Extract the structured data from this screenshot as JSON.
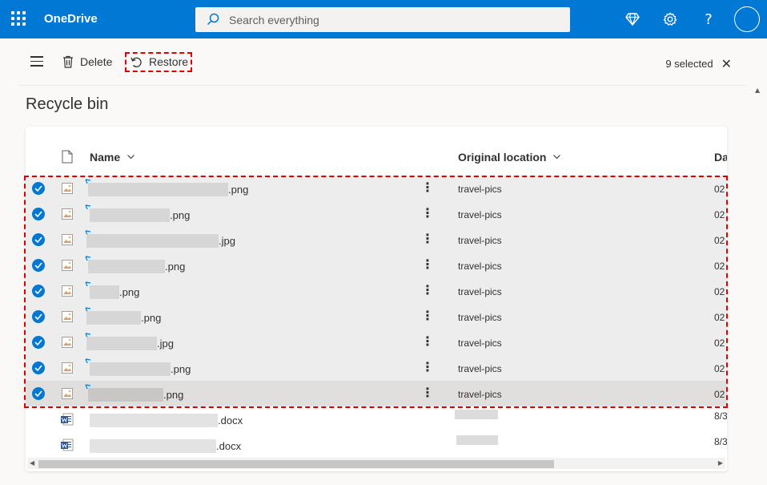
{
  "app": {
    "title": "OneDrive"
  },
  "search": {
    "placeholder": "Search everything"
  },
  "toolbar": {
    "delete_label": "Delete",
    "restore_label": "Restore",
    "selection_count": "9 selected"
  },
  "page": {
    "title": "Recycle bin"
  },
  "table": {
    "columns": {
      "name": "Name",
      "location": "Original location",
      "date": "Da"
    },
    "rows": [
      {
        "ext": ".png",
        "location": "travel-pics",
        "date": "02",
        "selected": true
      },
      {
        "ext": ".png",
        "location": "travel-pics",
        "date": "02",
        "selected": true
      },
      {
        "ext": ".jpg",
        "location": "travel-pics",
        "date": "02",
        "selected": true
      },
      {
        "ext": ".png",
        "location": "travel-pics",
        "date": "02",
        "selected": true
      },
      {
        "ext": ".png",
        "location": "travel-pics",
        "date": "02",
        "selected": true
      },
      {
        "ext": ".png",
        "location": "travel-pics",
        "date": "02",
        "selected": true
      },
      {
        "ext": ".jpg",
        "location": "travel-pics",
        "date": "02",
        "selected": true
      },
      {
        "ext": ".png",
        "location": "travel-pics",
        "date": "02",
        "selected": true
      },
      {
        "ext": ".png",
        "location": "travel-pics",
        "date": "02",
        "selected": true
      },
      {
        "ext": ".docx",
        "location": "",
        "date": "8/3",
        "selected": false
      },
      {
        "ext": ".docx",
        "location": "",
        "date": "8/3",
        "selected": false
      }
    ]
  },
  "icons": {
    "waffle": "app-launcher-icon",
    "search": "search-icon",
    "premium": "diamond-icon",
    "settings": "gear-icon",
    "help": "help-icon",
    "delete": "trash-icon",
    "restore": "restore-icon",
    "close": "close-icon"
  },
  "colors": {
    "brand": "#0078d4",
    "highlight": "#e00000"
  }
}
